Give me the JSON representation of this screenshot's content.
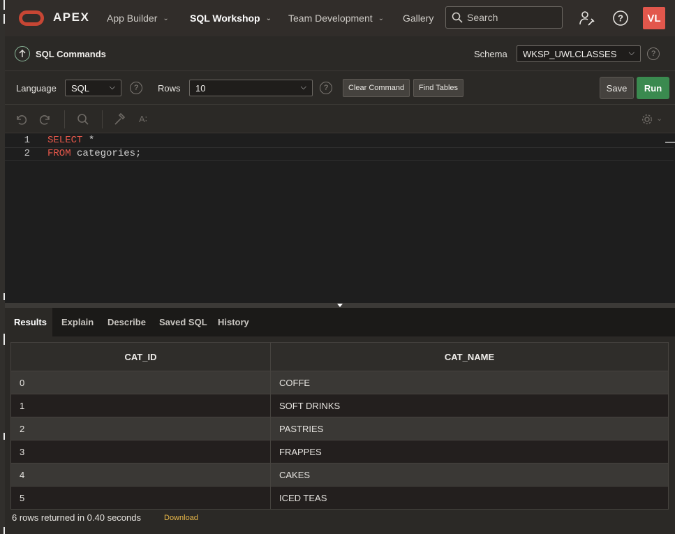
{
  "app": {
    "title": "APEX",
    "nav": [
      {
        "label": "App Builder",
        "has_menu": true
      },
      {
        "label": "SQL Workshop",
        "has_menu": true,
        "active": true
      },
      {
        "label": "Team Development",
        "has_menu": true
      },
      {
        "label": "Gallery",
        "has_menu": false
      }
    ],
    "search_placeholder": "Search",
    "avatar_initials": "VL",
    "icons": [
      "user-wrench-icon",
      "help-icon"
    ]
  },
  "page": {
    "title": "SQL Commands",
    "schema_label": "Schema",
    "schema_value": "WKSP_UWLCLASSES"
  },
  "options": {
    "language_label": "Language",
    "language_value": "SQL",
    "rows_label": "Rows",
    "rows_value": "10",
    "clear_label": "Clear Command",
    "find_tables_label": "Find Tables",
    "save_label": "Save",
    "run_label": "Run"
  },
  "editor": {
    "lines": [
      {
        "num": "1",
        "keyword": "SELECT",
        "rest": " *"
      },
      {
        "num": "2",
        "keyword": "FROM",
        "rest": " categories;"
      }
    ]
  },
  "tabs": [
    "Results",
    "Explain",
    "Describe",
    "Saved SQL",
    "History"
  ],
  "results": {
    "columns": [
      "CAT_ID",
      "CAT_NAME"
    ],
    "rows": [
      [
        "0",
        "COFFE"
      ],
      [
        "1",
        "SOFT DRINKS"
      ],
      [
        "2",
        "PASTRIES"
      ],
      [
        "3",
        "FRAPPES"
      ],
      [
        "4",
        "CAKES"
      ],
      [
        "5",
        "ICED TEAS"
      ]
    ],
    "summary": "6 rows returned in 0.40 seconds",
    "download_label": "Download"
  },
  "colors": {
    "brand_red": "#c74634",
    "run_green": "#3a8a4f",
    "keyword_red": "#e8584b",
    "link_yellow": "#e8b84a",
    "avatar_red": "#e2574c"
  }
}
